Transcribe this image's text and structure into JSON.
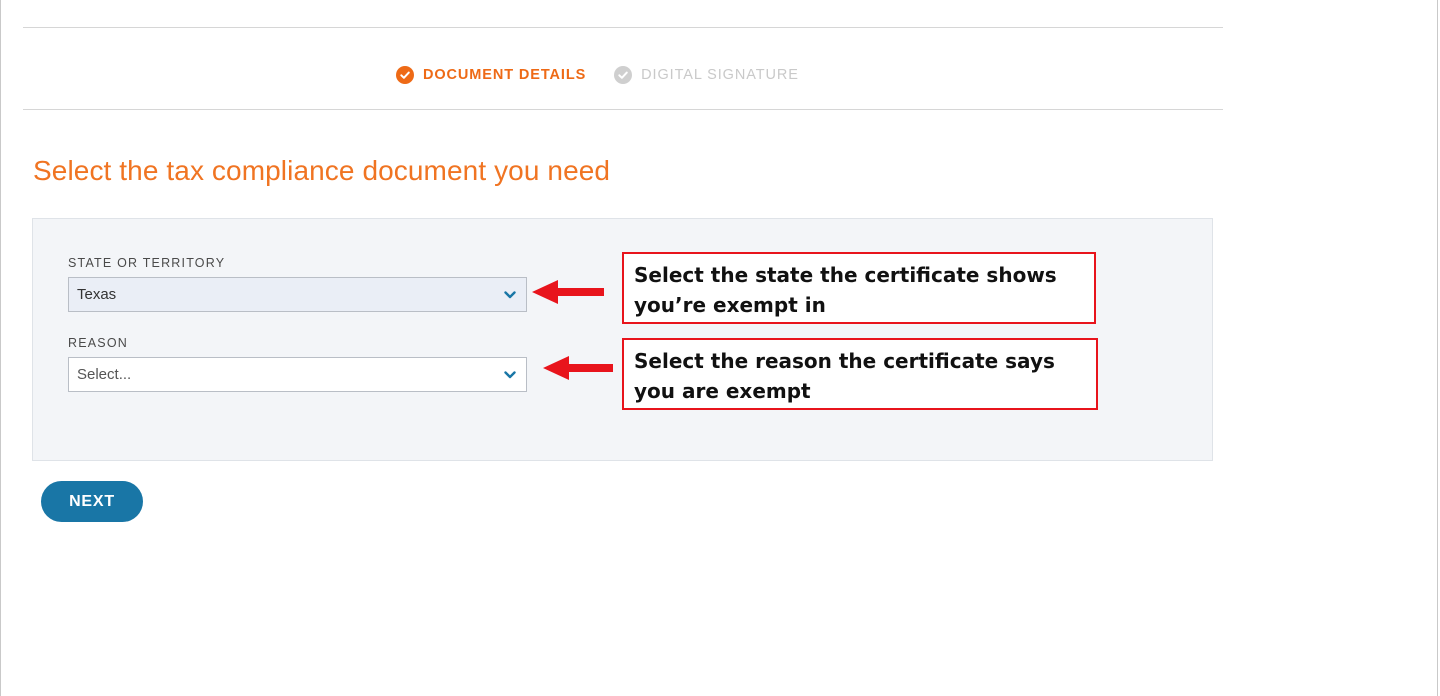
{
  "stepper": {
    "steps": [
      {
        "label": "DOCUMENT DETAILS",
        "state": "active"
      },
      {
        "label": "DIGITAL SIGNATURE",
        "state": "inactive"
      }
    ]
  },
  "page": {
    "title": "Select the tax compliance document you need"
  },
  "form": {
    "state_field": {
      "label": "STATE OR TERRITORY",
      "value": "Texas"
    },
    "reason_field": {
      "label": "REASON",
      "placeholder": "Select..."
    }
  },
  "annotations": {
    "state_callout": "Select the state the certificate shows you’re exempt in",
    "reason_callout": "Select the reason the certificate says you are exempt"
  },
  "actions": {
    "next_label": "NEXT"
  },
  "colors": {
    "accent_orange": "#ee6a16",
    "primary_blue": "#1976a6",
    "annotation_red": "#e8141c"
  }
}
